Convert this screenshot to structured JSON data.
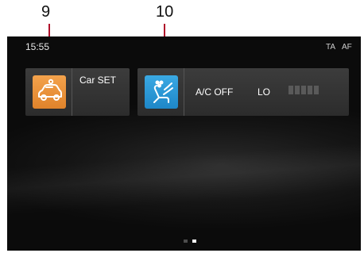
{
  "callouts": {
    "a": "9",
    "b": "10"
  },
  "status": {
    "time": "15:55",
    "ta": "TA",
    "af": "AF"
  },
  "tiles": {
    "car": {
      "label": "Car SET",
      "icon": "car-settings-icon"
    },
    "ac": {
      "label": "A/C OFF",
      "mode": "LO",
      "icon": "climate-seat-fan-icon",
      "fan_level_bars": 5
    }
  },
  "pager": {
    "pages": 2,
    "active_index": 1
  },
  "colors": {
    "car_icon_bg": "#e8902f",
    "ac_icon_bg": "#2b97d4",
    "callout_line": "#b0102a"
  }
}
